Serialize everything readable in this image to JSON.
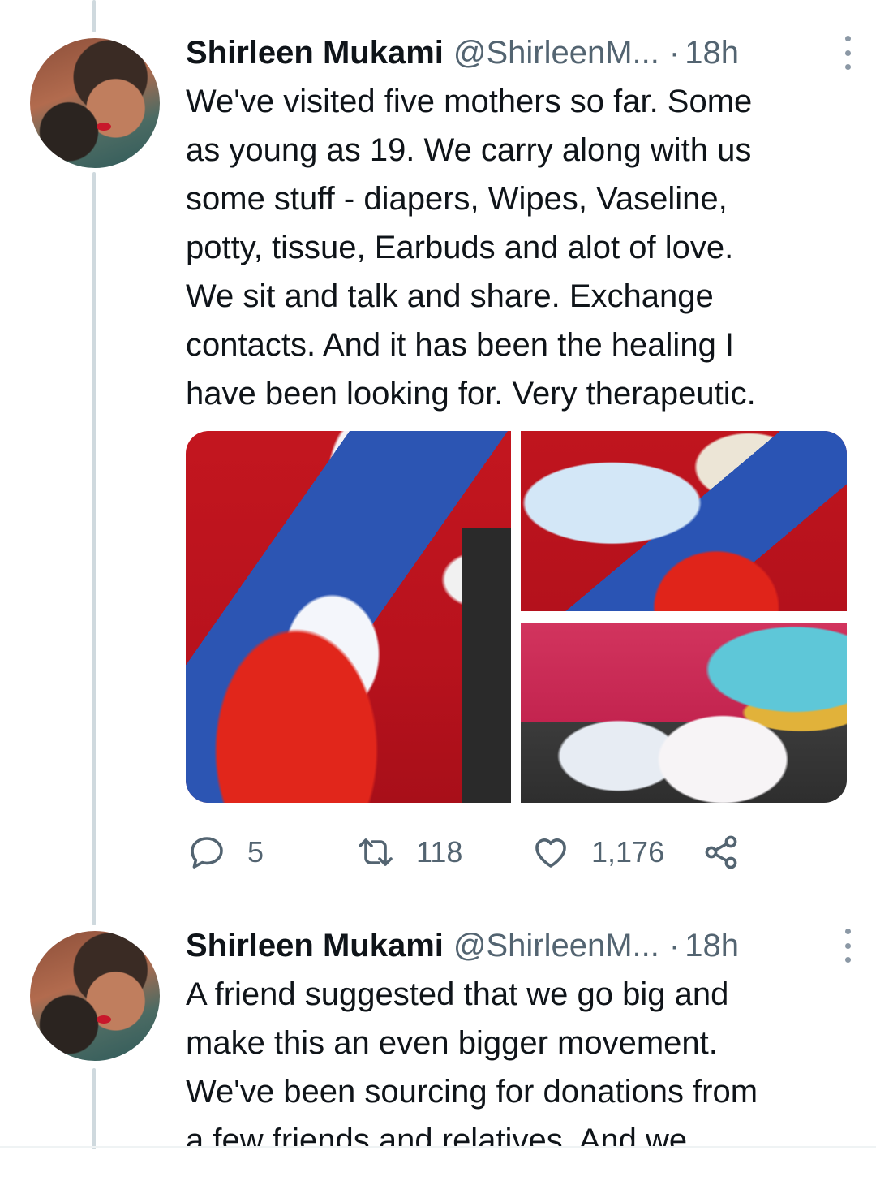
{
  "thread": {
    "tweets": [
      {
        "author_name": "Shirleen Mukami",
        "author_handle": "@ShirleenM...",
        "separator": "·",
        "time": "18h",
        "text": "We've visited five mothers so far. Some\nas young as 19. We carry along with us\nsome stuff - diapers, Wipes, Vaseline,\npotty, tissue, Earbuds and alot of love.\nWe sit and talk and share. Exchange\ncontacts. And it has been the healing I\nhave been looking for. Very therapeutic.",
        "media": {
          "photo_count": 3
        },
        "actions": {
          "reply_count": "5",
          "retweet_count": "118",
          "like_count": "1,176",
          "icons": [
            "reply-icon",
            "retweet-icon",
            "like-icon",
            "share-icon"
          ]
        }
      },
      {
        "author_name": "Shirleen Mukami",
        "author_handle": "@ShirleenM...",
        "separator": "·",
        "time": "18h",
        "text": "A friend suggested that we go big and\nmake this an even bigger movement.\nWe've been sourcing for donations from\na few friends and relatives. And we"
      }
    ]
  },
  "colors": {
    "text_primary": "#0f1419",
    "text_secondary": "#536471",
    "thread_line": "#cfd9de"
  }
}
